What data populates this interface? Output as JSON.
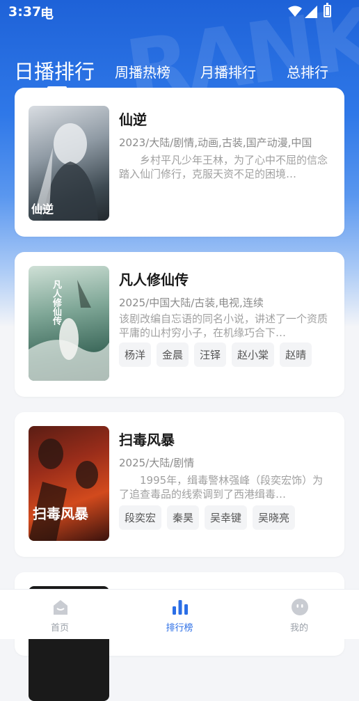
{
  "status_bar": {
    "time": "3:37",
    "carrier_glyph": "电"
  },
  "tabs": [
    {
      "label": "日播排行",
      "active": true
    },
    {
      "label": "周播热榜",
      "active": false
    },
    {
      "label": "月播排行",
      "active": false
    },
    {
      "label": "总排行",
      "active": false
    }
  ],
  "cards": [
    {
      "title": "仙逆",
      "meta": "2023/大陆/剧情,动画,古装,国产动漫,中国",
      "description": "　　乡村平凡少年王林，为了心中不屈的信念踏入仙门修行，克服天资不足的困境…",
      "cast": [],
      "poster_text": "仙逆"
    },
    {
      "title": "凡人修仙传",
      "meta": "2025/中国大陆/古装,电视,连续",
      "description": "该剧改编自忘语的同名小说，讲述了一个资质平庸的山村穷小子，在机缘巧合下…",
      "cast": [
        "杨洋",
        "金晨",
        "汪铎",
        "赵小棠",
        "赵晴"
      ],
      "poster_text": "凡人修仙传"
    },
    {
      "title": "扫毒风暴",
      "meta": "2025/大陆/剧情",
      "description": "　　1995年，缉毒警林强峰（段奕宏饰）为了追查毒品的线索调到了西港缉毒…",
      "cast": [
        "段奕宏",
        "秦昊",
        "吴幸键",
        "吴晓亮"
      ],
      "poster_text": "扫毒风暴"
    }
  ],
  "bottom_nav": [
    {
      "label": "首页",
      "icon": "home-icon",
      "active": false
    },
    {
      "label": "排行榜",
      "icon": "ranking-icon",
      "active": true
    },
    {
      "label": "我的",
      "icon": "profile-icon",
      "active": false
    }
  ],
  "colors": {
    "accent": "#2b6ee6",
    "header_gradient_top": "#1e62d8"
  }
}
